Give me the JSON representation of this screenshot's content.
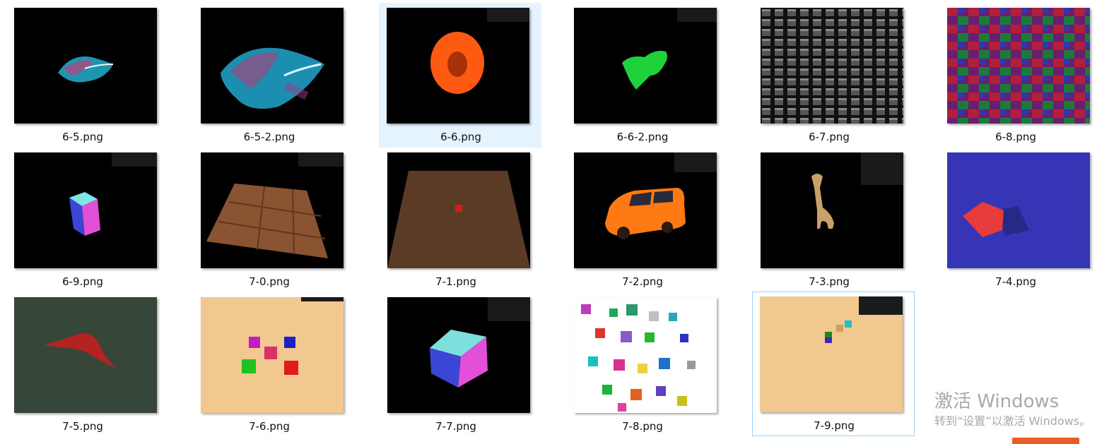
{
  "files": [
    {
      "name": "6-5.png"
    },
    {
      "name": "6-5-2.png"
    },
    {
      "name": "6-6.png",
      "selected": true
    },
    {
      "name": "6-6-2.png"
    },
    {
      "name": "6-7.png"
    },
    {
      "name": "6-8.png"
    },
    {
      "name": "6-9.png"
    },
    {
      "name": "7-0.png"
    },
    {
      "name": "7-1.png"
    },
    {
      "name": "7-2.png"
    },
    {
      "name": "7-3.png"
    },
    {
      "name": "7-4.png"
    },
    {
      "name": "7-5.png"
    },
    {
      "name": "7-6.png"
    },
    {
      "name": "7-7.png"
    },
    {
      "name": "7-8.png"
    },
    {
      "name": "7-9.png",
      "focused": true
    }
  ],
  "activation": {
    "title": "激活 Windows",
    "subtitle": "转到“设置”以激活 Windows。"
  }
}
